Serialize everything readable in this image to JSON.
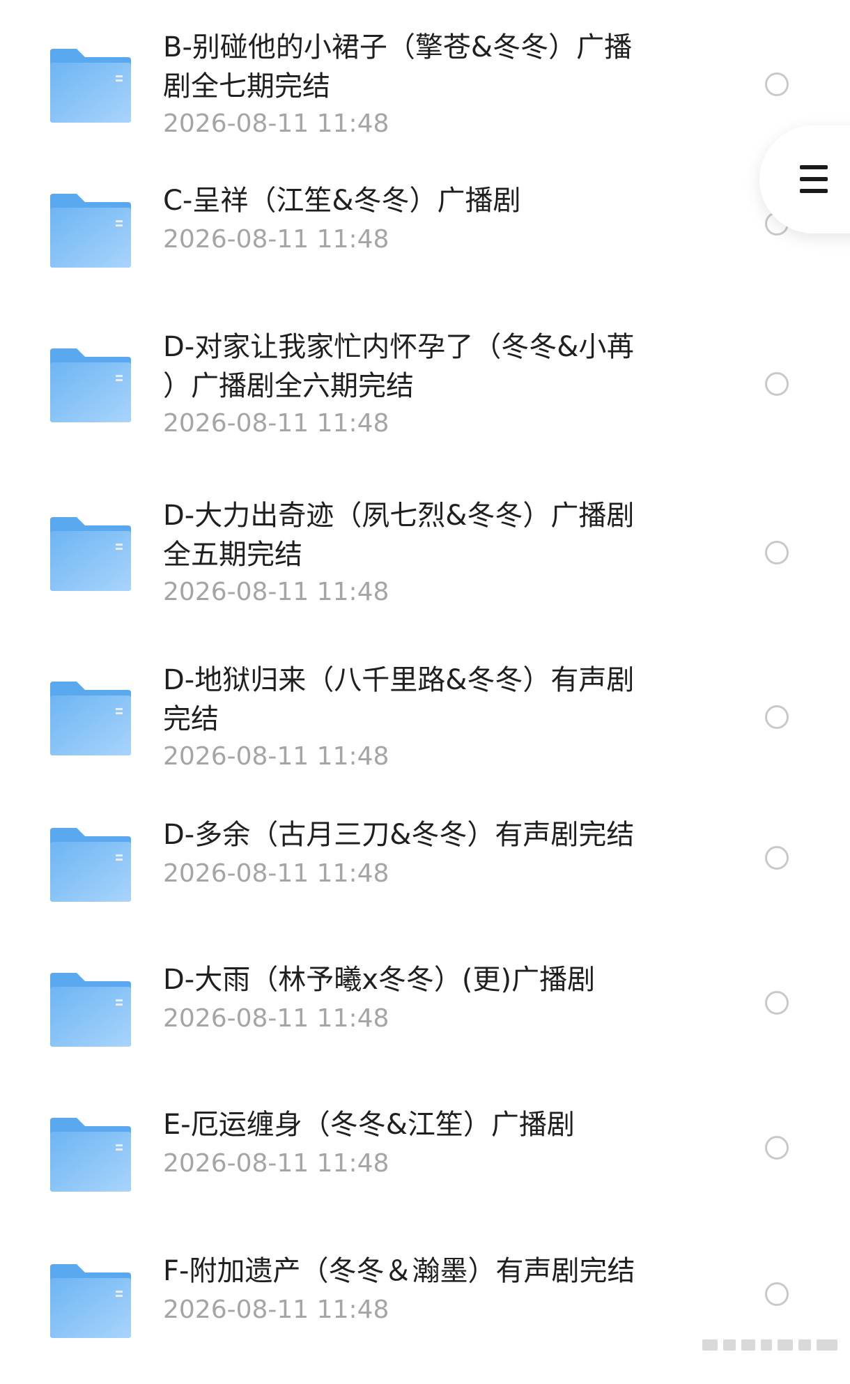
{
  "files": [
    {
      "title_lines": [
        "B-别碰他的小裙子（擎苍&冬冬）广播",
        "剧全七期完结"
      ],
      "date": "2026-08-11 11:48",
      "icon": "folder-icon"
    },
    {
      "title_lines": [
        "C-呈祥（江笙&冬冬）广播剧"
      ],
      "date": "2026-08-11 11:48",
      "icon": "folder-icon"
    },
    {
      "title_lines": [
        "D-对家让我家忙内怀孕了（冬冬&小苒",
        "）广播剧全六期完结"
      ],
      "date": "2026-08-11 11:48",
      "icon": "folder-icon"
    },
    {
      "title_lines": [
        "D-大力出奇迹（夙七烈&冬冬）广播剧",
        "全五期完结"
      ],
      "date": "2026-08-11 11:48",
      "icon": "folder-icon"
    },
    {
      "title_lines": [
        "D-地狱归来（八千里路&冬冬）有声剧",
        "完结"
      ],
      "date": "2026-08-11 11:48",
      "icon": "folder-icon"
    },
    {
      "title_lines": [
        "D-多余（古月三刀&冬冬）有声剧完结"
      ],
      "date": "2026-08-11 11:48",
      "icon": "folder-icon"
    },
    {
      "title_lines": [
        "D-大雨（林予曦x冬冬）(更)广播剧"
      ],
      "date": "2026-08-11 11:48",
      "icon": "folder-icon"
    },
    {
      "title_lines": [
        "E-厄运缠身（冬冬&江笙）广播剧"
      ],
      "date": "2026-08-11 11:48",
      "icon": "folder-icon"
    },
    {
      "title_lines": [
        "F-附加遗产（冬冬＆瀚墨）有声剧完结"
      ],
      "date": "2026-08-11 11:48",
      "icon": "folder-icon"
    }
  ],
  "menu_button": {
    "icon": "menu-icon"
  },
  "colors": {
    "folder_back": "#5aa8ee",
    "folder_front_top": "#6db5f3",
    "folder_front_bottom": "#a9d4fb",
    "title_text": "#1f1f1f",
    "date_text": "#a5a5a5",
    "radio_border": "#c9c9c9"
  }
}
